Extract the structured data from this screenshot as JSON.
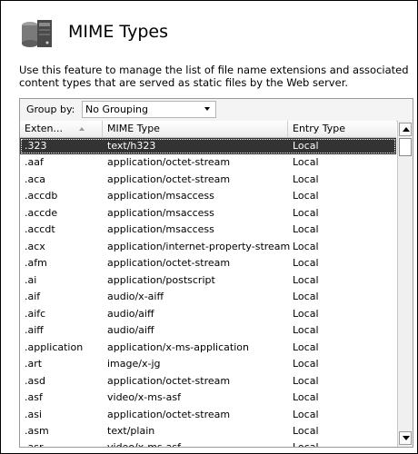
{
  "header": {
    "title": "MIME Types",
    "icon": "server-icon"
  },
  "description": "Use this feature to manage the list of file name extensions and associated content types that are served as static files by the Web server.",
  "group_by": {
    "label": "Group by:",
    "value": "No Grouping"
  },
  "columns": {
    "ext": "Exten...",
    "mime": "MIME Type",
    "type": "Entry Type"
  },
  "rows": [
    {
      "ext": ".323",
      "mime": "text/h323",
      "type": "Local",
      "selected": true
    },
    {
      "ext": ".aaf",
      "mime": "application/octet-stream",
      "type": "Local"
    },
    {
      "ext": ".aca",
      "mime": "application/octet-stream",
      "type": "Local"
    },
    {
      "ext": ".accdb",
      "mime": "application/msaccess",
      "type": "Local"
    },
    {
      "ext": ".accde",
      "mime": "application/msaccess",
      "type": "Local"
    },
    {
      "ext": ".accdt",
      "mime": "application/msaccess",
      "type": "Local"
    },
    {
      "ext": ".acx",
      "mime": "application/internet-property-stream",
      "type": "Local"
    },
    {
      "ext": ".afm",
      "mime": "application/octet-stream",
      "type": "Local"
    },
    {
      "ext": ".ai",
      "mime": "application/postscript",
      "type": "Local"
    },
    {
      "ext": ".aif",
      "mime": "audio/x-aiff",
      "type": "Local"
    },
    {
      "ext": ".aifc",
      "mime": "audio/aiff",
      "type": "Local"
    },
    {
      "ext": ".aiff",
      "mime": "audio/aiff",
      "type": "Local"
    },
    {
      "ext": ".application",
      "mime": "application/x-ms-application",
      "type": "Local"
    },
    {
      "ext": ".art",
      "mime": "image/x-jg",
      "type": "Local"
    },
    {
      "ext": ".asd",
      "mime": "application/octet-stream",
      "type": "Local"
    },
    {
      "ext": ".asf",
      "mime": "video/x-ms-asf",
      "type": "Local"
    },
    {
      "ext": ".asi",
      "mime": "application/octet-stream",
      "type": "Local"
    },
    {
      "ext": ".asm",
      "mime": "text/plain",
      "type": "Local"
    },
    {
      "ext": ".asr",
      "mime": "video/x-ms-asf",
      "type": "Local"
    }
  ],
  "colors": {
    "selected_row": "#333333",
    "border": "#9a9a9a"
  }
}
